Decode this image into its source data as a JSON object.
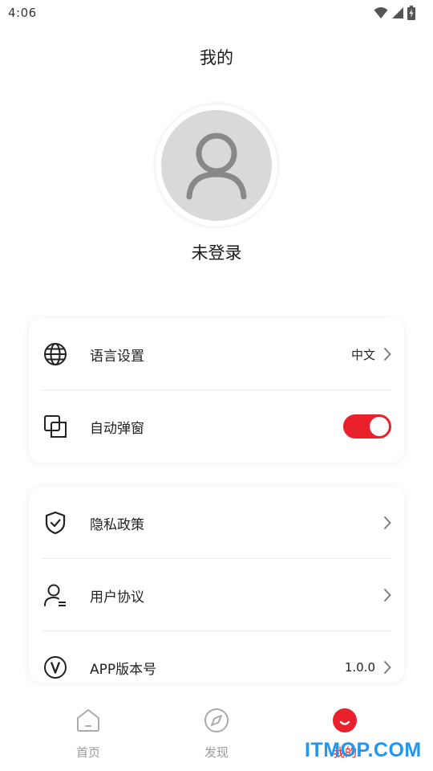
{
  "status_bar": {
    "time": "4:06"
  },
  "header": {
    "title": "我的"
  },
  "profile": {
    "login_status": "未登录"
  },
  "settings_card": {
    "language": {
      "label": "语言设置",
      "value": "中文"
    },
    "auto_popup": {
      "label": "自动弹窗",
      "enabled": true
    }
  },
  "info_card": {
    "privacy": {
      "label": "隐私政策"
    },
    "agreement": {
      "label": "用户协议"
    },
    "version": {
      "label": "APP版本号",
      "value": "1.0.0"
    }
  },
  "tabbar": {
    "items": [
      {
        "label": "首页",
        "icon": "home-icon",
        "active": false
      },
      {
        "label": "发现",
        "icon": "compass-icon",
        "active": false
      },
      {
        "label": "我的",
        "icon": "smile-icon",
        "active": true
      }
    ]
  },
  "watermark": {
    "text": "ITMOP.COM"
  },
  "colors": {
    "accent": "#e8212b",
    "watermark": "#2196f3"
  }
}
